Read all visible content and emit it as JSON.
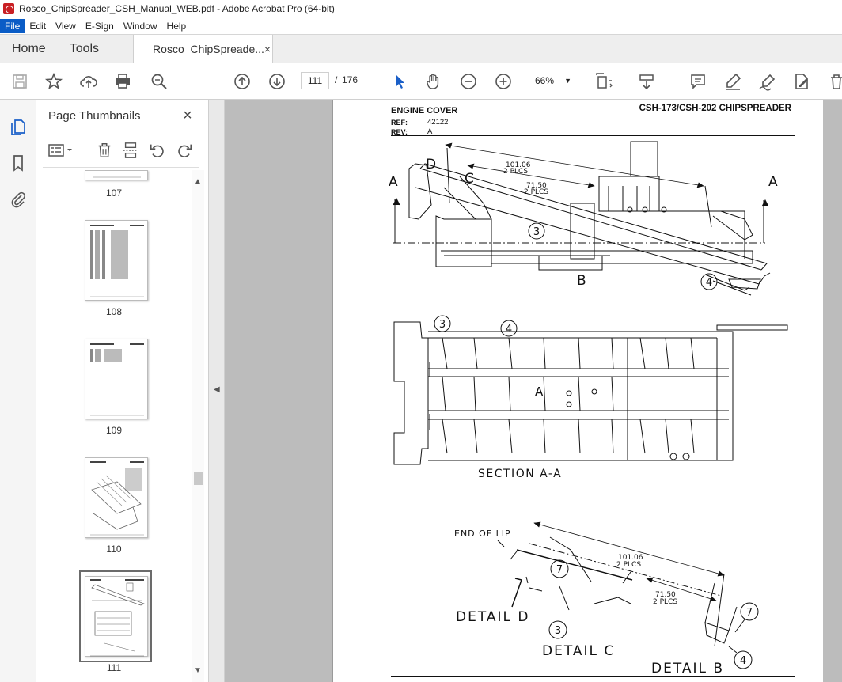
{
  "window": {
    "title": "Rosco_ChipSpreader_CSH_Manual_WEB.pdf - Adobe Acrobat Pro (64-bit)"
  },
  "menu": [
    "File",
    "Edit",
    "View",
    "E-Sign",
    "Window",
    "Help"
  ],
  "tabs": {
    "home": "Home",
    "tools": "Tools",
    "document": "Rosco_ChipSpreade...",
    "close": "×"
  },
  "toolbar": {
    "current_page": "111",
    "page_separator": "/",
    "total_pages": "176",
    "zoom": "66%"
  },
  "thumbnails_panel": {
    "title": "Page Thumbnails",
    "close": "×",
    "pages": [
      {
        "label": "107"
      },
      {
        "label": "108"
      },
      {
        "label": "109"
      },
      {
        "label": "110"
      },
      {
        "label": "111"
      }
    ],
    "selected_page": "111"
  },
  "document": {
    "header_title": "ENGINE COVER",
    "header_right": "CSH-173/CSH-202 CHIPSPREADER",
    "ref_label": "REF:",
    "ref_value": "42122",
    "rev_label": "REV:",
    "rev_value": "A",
    "drawing": {
      "dim_outer": "101.06",
      "dim_outer_sub": "2 PLCS",
      "dim_inner": "71.50",
      "dim_inner_sub": "2 PLCS",
      "label_a": "A",
      "label_b": "B",
      "label_c": "C",
      "label_d": "D",
      "callout_3": "3",
      "callout_4": "4",
      "callout_7": "7",
      "section_label": "SECTION A-A",
      "end_of_lip": "END OF LIP",
      "detail_d": "DETAIL D",
      "detail_c": "DETAIL C",
      "detail_b": "DETAIL B"
    }
  }
}
